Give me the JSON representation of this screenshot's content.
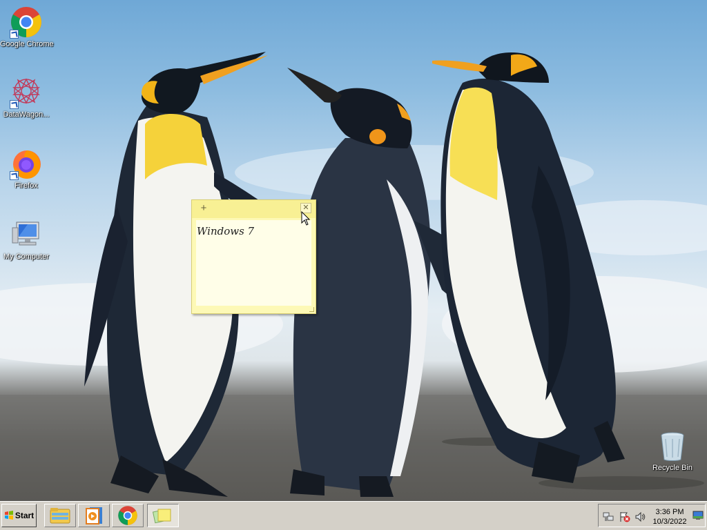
{
  "desktop": {
    "icons": [
      {
        "label": "Google Chrome",
        "icon": "chrome-icon"
      },
      {
        "label": "DataWagon...",
        "icon": "datawagon-icon"
      },
      {
        "label": "Firefox",
        "icon": "firefox-icon"
      },
      {
        "label": "My Computer",
        "icon": "computer-icon"
      },
      {
        "label": "Recycle Bin",
        "icon": "recycle-bin-icon"
      }
    ]
  },
  "sticky_note": {
    "text": "Windows 7",
    "add_glyph": "+",
    "close_glyph": "✕",
    "color": "#fdf9b6"
  },
  "taskbar": {
    "start_label": "Start",
    "buttons": [
      {
        "icon": "file-explorer-icon"
      },
      {
        "icon": "media-player-icon"
      },
      {
        "icon": "chrome-icon"
      },
      {
        "icon": "sticky-notes-icon",
        "active": true
      }
    ],
    "tray": {
      "icons": [
        "network-icon",
        "action-center-icon",
        "volume-icon",
        "show-desktop-icon"
      ],
      "time": "3:36 PM",
      "date": "10/3/2022"
    }
  }
}
